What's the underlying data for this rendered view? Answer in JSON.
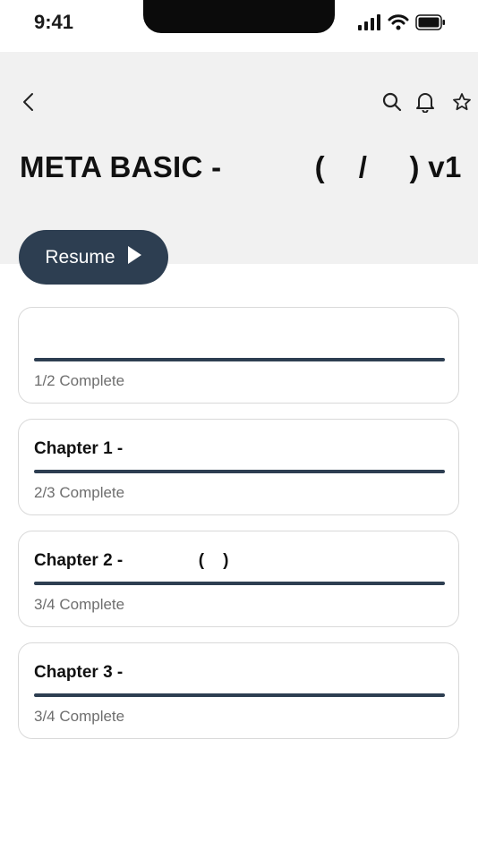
{
  "status_bar": {
    "time": "9:41"
  },
  "header": {
    "title": "META BASIC -           (    /     ) v1"
  },
  "resume_button": {
    "label": "Resume"
  },
  "cards": [
    {
      "title": "",
      "status": "1/2 Complete",
      "progress": 0.5
    },
    {
      "title": "Chapter 1 -",
      "status": "2/3 Complete",
      "progress": 0.6667
    },
    {
      "title": "Chapter 2 -                (    )",
      "status": "3/4 Complete",
      "progress": 0.75
    },
    {
      "title": "Chapter 3 -",
      "status": "3/4 Complete",
      "progress": 0.75
    }
  ],
  "colors": {
    "accent": "#2d3e51",
    "header_bg": "#f1f1f1",
    "muted_text": "#6e6e6e"
  },
  "icons": [
    "chevron-left-icon",
    "search-icon",
    "bell-icon",
    "star-icon",
    "play-icon",
    "signal-icon",
    "wifi-icon",
    "battery-icon"
  ]
}
